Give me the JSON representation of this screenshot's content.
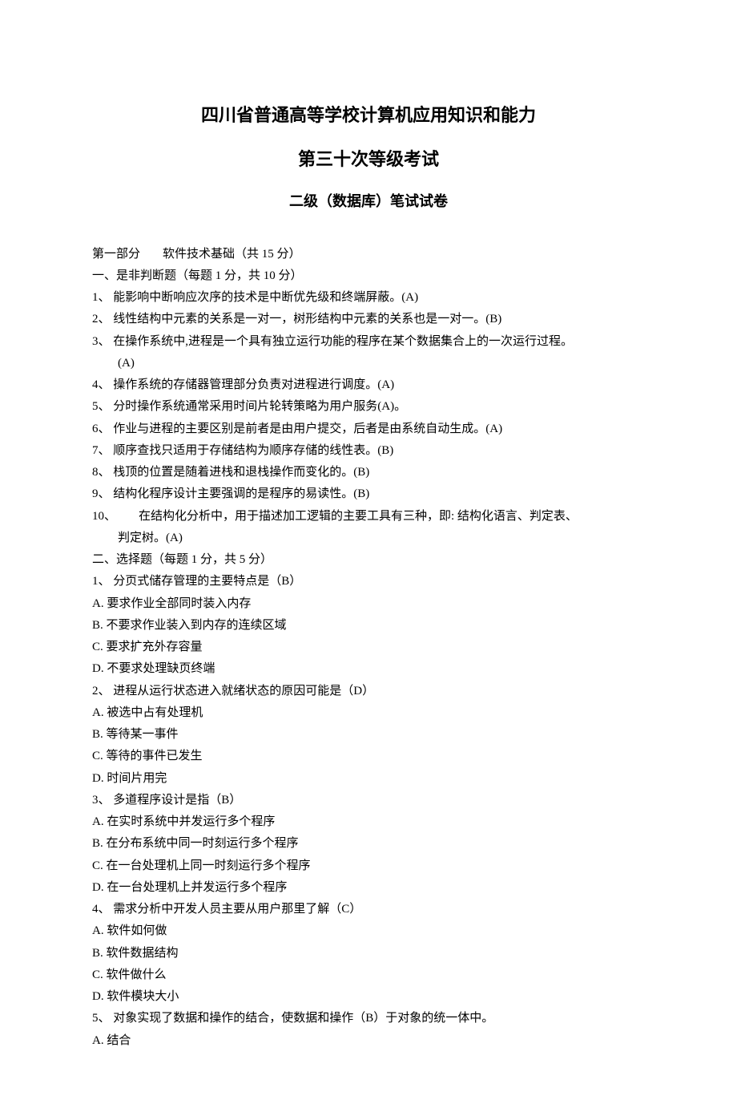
{
  "title_main": "四川省普通高等学校计算机应用知识和能力",
  "title_sub": "第三十次等级考试",
  "title_paper": "二级（数据库）笔试试卷",
  "part1_header_prefix": "第一部分",
  "part1_header_suffix": "软件技术基础（共 15 分）",
  "sec1_header": "一、是非判断题（每题 1 分，共 10 分）",
  "tf_items": [
    "1、 能影响中断响应次序的技术是中断优先级和终端屏蔽。(A)",
    "2、 线性结构中元素的关系是一对一，树形结构中元素的关系也是一对一。(B)"
  ],
  "tf_item3_line1": "3、 在操作系统中,进程是一个具有独立运行功能的程序在某个数据集合上的一次运行过程。",
  "tf_item3_line2": "(A)",
  "tf_items_cont": [
    "4、 操作系统的存储器管理部分负责对进程进行调度。(A)",
    "5、 分时操作系统通常采用时间片轮转策略为用户服务(A)。",
    "6、 作业与进程的主要区别是前者是由用户提交，后者是由系统自动生成。(A)",
    "7、 顺序查找只适用于存储结构为顺序存储的线性表。(B)",
    "8、 栈顶的位置是随着进栈和退栈操作而变化的。(B)",
    "9、 结构化程序设计主要强调的是程序的易读性。(B)"
  ],
  "tf_item10_prefix": "10、",
  "tf_item10_line1": "在结构化分析中，用于描述加工逻辑的主要工具有三种，即: 结构化语言、判定表、",
  "tf_item10_line2": "判定树。(A)",
  "sec2_header": "二、选择题（每题 1 分，共 5 分）",
  "mc": [
    {
      "q": "1、 分页式储存管理的主要特点是（B）",
      "opts": [
        "A.  要求作业全部同时装入内存",
        "B.  不要求作业装入到内存的连续区域",
        "C.  要求扩充外存容量",
        "D.  不要求处理缺页终端"
      ]
    },
    {
      "q": "2、 进程从运行状态进入就绪状态的原因可能是（D）",
      "opts": [
        "A.  被选中占有处理机",
        "B.  等待某一事件",
        "C.  等待的事件已发生",
        "D.  时间片用完"
      ]
    },
    {
      "q": "3、 多道程序设计是指（B）",
      "opts": [
        "A.  在实时系统中并发运行多个程序",
        "B.  在分布系统中同一时刻运行多个程序",
        "C.  在一台处理机上同一时刻运行多个程序",
        "D.  在一台处理机上并发运行多个程序"
      ]
    },
    {
      "q": "4、 需求分析中开发人员主要从用户那里了解（C）",
      "opts": [
        "A.  软件如何做",
        "B.  软件数据结构",
        "C.  软件做什么",
        "D.  软件模块大小"
      ]
    },
    {
      "q": "5、 对象实现了数据和操作的结合，使数据和操作（B）于对象的统一体中。",
      "opts": [
        "A.  结合"
      ]
    }
  ]
}
